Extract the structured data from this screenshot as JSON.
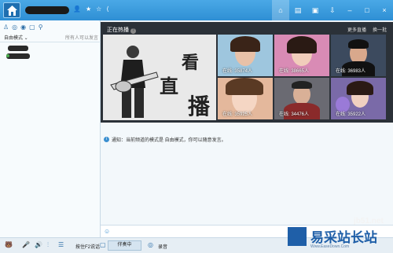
{
  "titlebar": {
    "icons": [
      "person-icon",
      "star-icon",
      "star-outline-icon",
      "share-icon"
    ],
    "right_icons": [
      "home-icon",
      "list-icon",
      "gift-icon",
      "download-icon",
      "minimize-icon",
      "maximize-icon",
      "close-icon"
    ]
  },
  "left": {
    "mode_label": "自由模式 ⌄",
    "mode_hint": "所有人可以发言"
  },
  "hot": {
    "title": "正在热播",
    "more": "更多直播",
    "refresh": "换一批",
    "banner_text": [
      "看",
      "直",
      "播"
    ],
    "tiles": [
      {
        "viewers": "在线: 35874人"
      },
      {
        "viewers": "在线: 38665人"
      },
      {
        "viewers": "在线: 36983人"
      },
      {
        "viewers": "在线: 35925人"
      },
      {
        "viewers": "在线: 34476人"
      },
      {
        "viewers": "在线: 35922人"
      }
    ]
  },
  "chat": {
    "notice": "通知：当前频道的模式是 自由模式，你可以随意发言。"
  },
  "bottom": {
    "key_label": "按住F2说话",
    "accompany": "伴奏中",
    "record": "录音"
  },
  "watermark": {
    "url": "jb51.net",
    "brand": "易采站长站",
    "sub": "Www.EaseDown.Com"
  },
  "colors": {
    "titlebar": "#2e8fd4",
    "hot_bg": "#2b3138",
    "accent": "#3a8fd0"
  }
}
